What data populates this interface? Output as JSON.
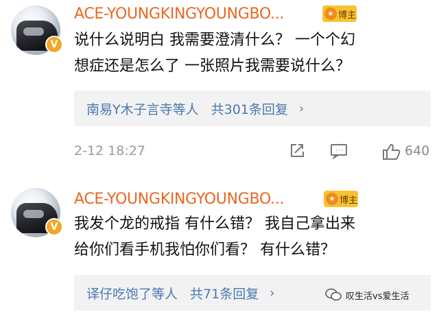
{
  "comments": [
    {
      "username": "ACE-YOUNGKINGYOUNGBO...",
      "badge_label": "博主",
      "text_lines": [
        "说什么说明白  我需要澄清什么？  一个个幻",
        "想症还是怎么了  一张照片我需要说什么？"
      ],
      "reply_names": "南易Y木子言寺等人",
      "reply_count": "共301条回复",
      "timestamp": "2-12  18:27",
      "like_count": "640"
    },
    {
      "username": "ACE-YOUNGKINGYOUNGBO...",
      "badge_label": "博主",
      "text_lines": [
        "我发个龙的戒指  有什么错？  我自己拿出来",
        "给你们看手机我怕你们看？  有什么错？"
      ],
      "reply_names": "译仔吃饱了等人",
      "reply_count": "共71条回复"
    }
  ],
  "watermark": {
    "text": "叹生活vs爱生活"
  },
  "icons": {
    "verified": "verified-v-icon",
    "share": "share-icon",
    "comment": "comment-icon",
    "like": "thumbs-up-icon",
    "chevron": "chevron-right-icon"
  },
  "colors": {
    "username": "#e86722",
    "reply_link": "#4a78b0",
    "reply_bg": "#f2f2f2",
    "badge_bg": "#f7c233"
  }
}
